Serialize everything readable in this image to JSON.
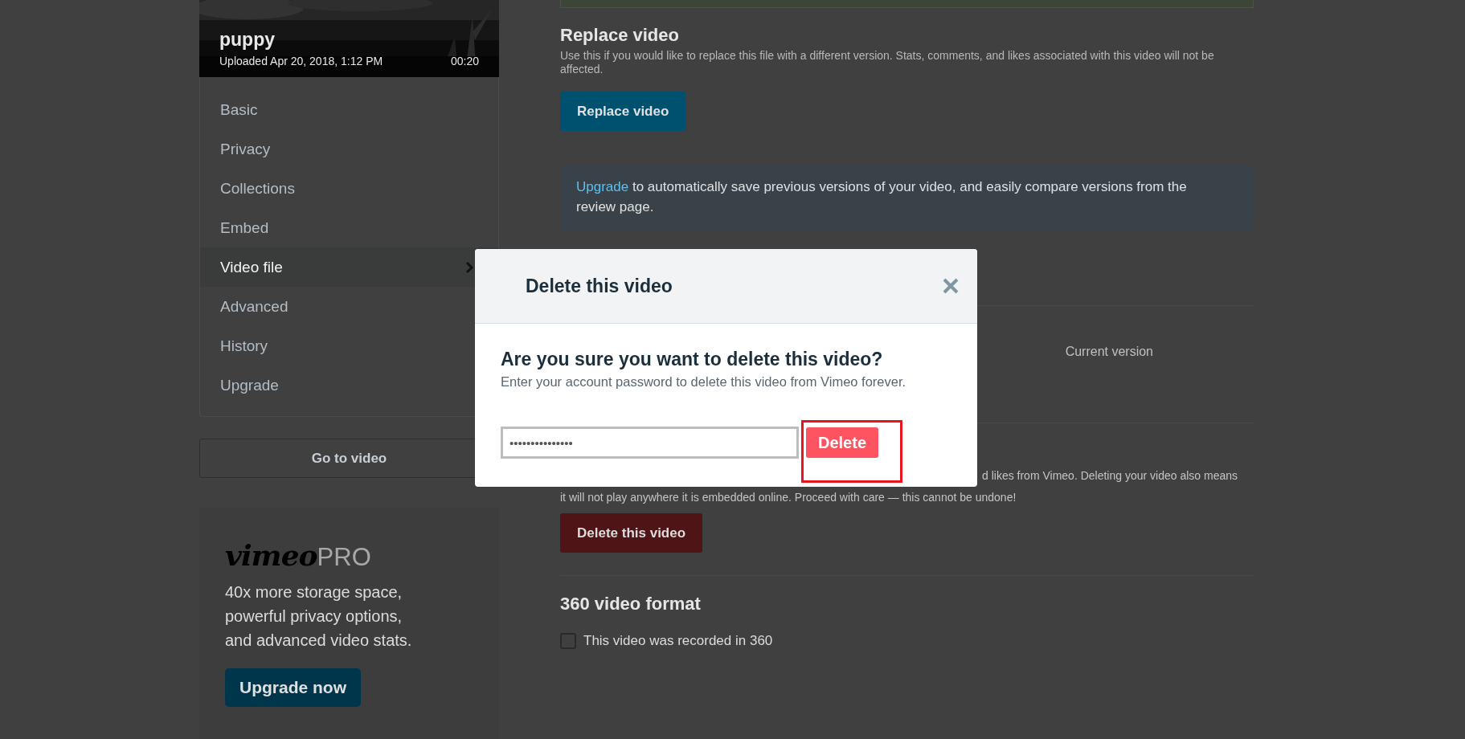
{
  "video": {
    "title": "puppy",
    "uploaded": "Uploaded Apr 20, 2018, 1:12 PM",
    "duration": "00:20"
  },
  "sidebar": {
    "items": [
      {
        "label": "Basic",
        "selected": false
      },
      {
        "label": "Privacy",
        "selected": false
      },
      {
        "label": "Collections",
        "selected": false
      },
      {
        "label": "Embed",
        "selected": false
      },
      {
        "label": "Video file",
        "selected": true
      },
      {
        "label": "Advanced",
        "selected": false
      },
      {
        "label": "History",
        "selected": false
      },
      {
        "label": "Upgrade",
        "selected": false
      }
    ],
    "go_button": "Go to video"
  },
  "promo": {
    "logo": "vimeo",
    "logo_suffix": "PRO",
    "text": "40x more storage space, powerful privacy options, and advanced video stats.",
    "button": "Upgrade now"
  },
  "replace": {
    "heading": "Replace video",
    "description": "Use this if you would like to replace this file with a different version. Stats, comments, and likes associated with this video will not be affected.",
    "button": "Replace video",
    "info_link": "Upgrade",
    "info_text": " to automatically save previous versions of your video, and easily compare versions from the review page."
  },
  "versions": {
    "column_label": "Current version"
  },
  "delete_section": {
    "text_line_1": "d likes from Vimeo. Deleting your video also means",
    "text_line_2": "it will not play anywhere it is embedded online. Proceed with care — this cannot be undone!",
    "button": "Delete this video"
  },
  "format_360": {
    "heading": "360 video format",
    "checkbox_label": "This video was recorded in 360",
    "checked": false
  },
  "modal": {
    "title": "Delete this video",
    "question": "Are you sure you want to delete this video?",
    "subtitle": "Enter your account password to delete this video from Vimeo forever.",
    "password": "•••••••••••••••",
    "button": "Delete",
    "highlighted": true
  }
}
